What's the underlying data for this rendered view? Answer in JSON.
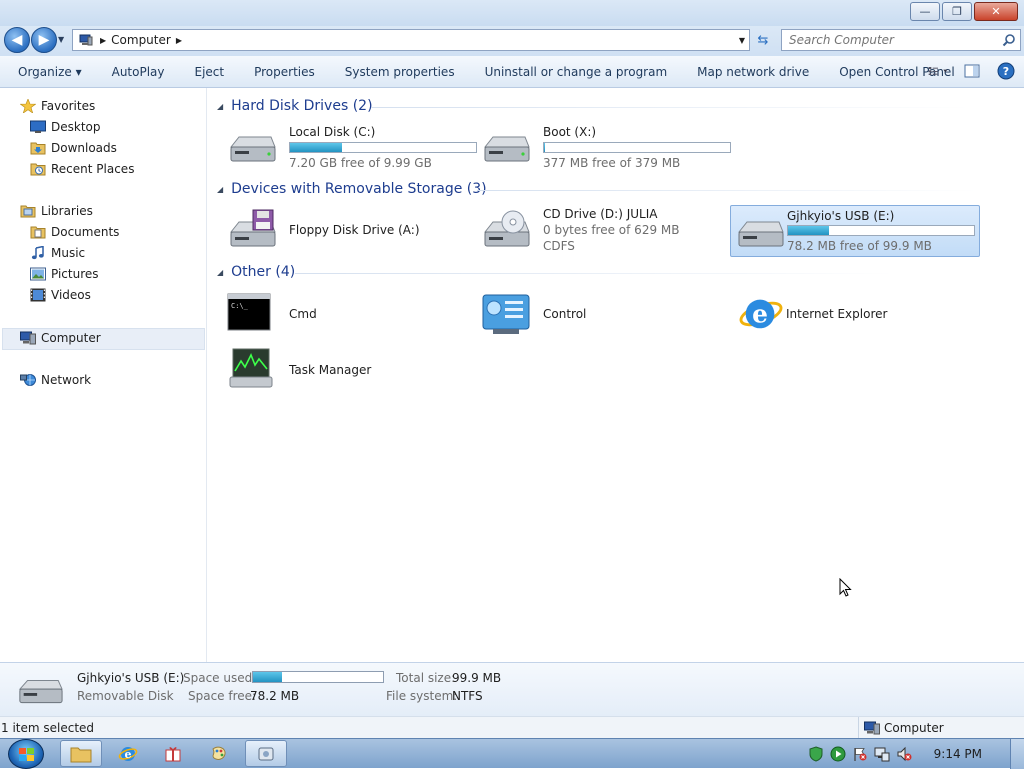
{
  "window": {
    "minimize_label": "—",
    "restore_label": "❐",
    "close_label": "✕"
  },
  "address": {
    "breadcrumb": "Computer",
    "search_placeholder": "Search Computer"
  },
  "toolbar": {
    "items": [
      "Organize ▾",
      "AutoPlay",
      "Eject",
      "Properties",
      "System properties",
      "Uninstall or change a program",
      "Map network drive",
      "Open Control Panel"
    ]
  },
  "sidebar": {
    "favorites": {
      "label": "Favorites",
      "items": [
        "Desktop",
        "Downloads",
        "Recent Places"
      ]
    },
    "libraries": {
      "label": "Libraries",
      "items": [
        "Documents",
        "Music",
        "Pictures",
        "Videos"
      ]
    },
    "computer": "Computer",
    "network": "Network"
  },
  "groups": {
    "hdd": {
      "title": "Hard Disk Drives (2)",
      "items": [
        {
          "name": "Local Disk (C:)",
          "free": "7.20 GB free of 9.99 GB",
          "used_fraction": 0.28
        },
        {
          "name": "Boot (X:)",
          "free": "377 MB free of 379 MB",
          "used_fraction": 0.005
        }
      ]
    },
    "removable": {
      "title": "Devices with Removable Storage (3)",
      "items": [
        {
          "name": "Floppy Disk Drive (A:)"
        },
        {
          "name": "CD Drive (D:) JULIA",
          "free": "0 bytes free of 629 MB",
          "fs": "CDFS"
        },
        {
          "name": "Gjhkyio's USB (E:)",
          "free": "78.2 MB free of 99.9 MB",
          "used_fraction": 0.22
        }
      ]
    },
    "other": {
      "title": "Other (4)",
      "items": [
        "Cmd",
        "Control",
        "Internet Explorer",
        "Task Manager"
      ]
    }
  },
  "details": {
    "name": "Gjhkyio's USB (E:)",
    "type": "Removable Disk",
    "space_used_label": "Space used:",
    "space_used_fraction": 0.22,
    "space_free_label": "Space free:",
    "space_free": "78.2 MB",
    "total_size_label": "Total size:",
    "total_size": "99.9 MB",
    "fs_label": "File system:",
    "fs": "NTFS"
  },
  "status": {
    "selected": "1 item selected",
    "location": "Computer"
  },
  "taskbar": {
    "clock": "9:14 PM"
  }
}
